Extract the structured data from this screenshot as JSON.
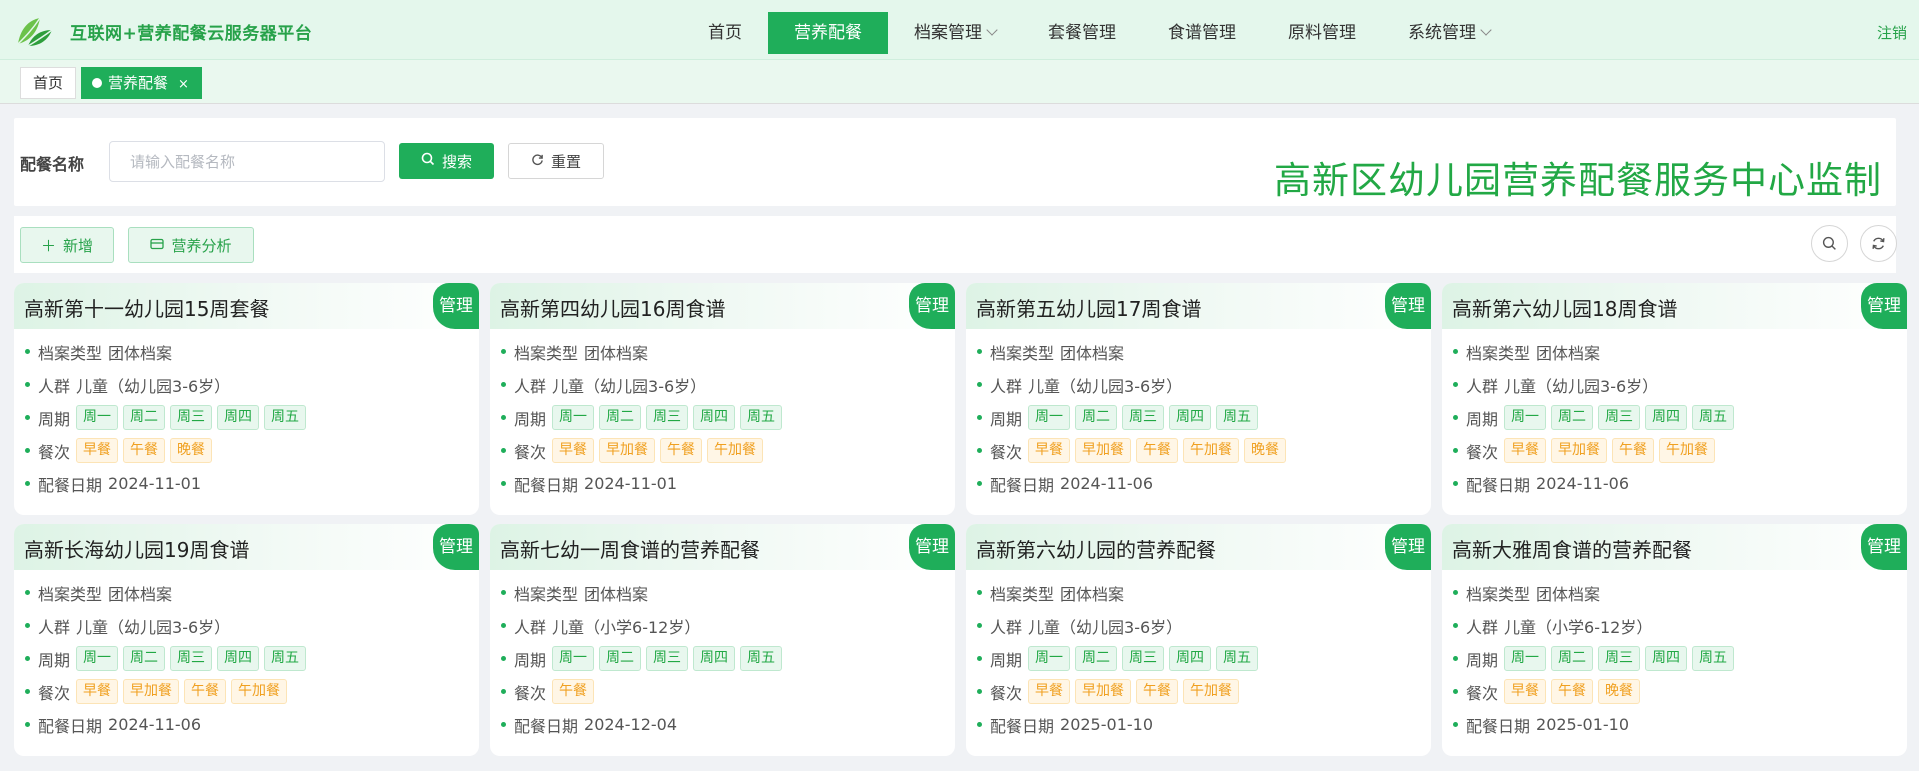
{
  "header": {
    "brand": "互联网+营养配餐云服务器平台",
    "menu": [
      {
        "label": "首页",
        "active": false,
        "dropdown": false
      },
      {
        "label": "营养配餐",
        "active": true,
        "dropdown": false
      },
      {
        "label": "档案管理",
        "active": false,
        "dropdown": true
      },
      {
        "label": "套餐管理",
        "active": false,
        "dropdown": false
      },
      {
        "label": "食谱管理",
        "active": false,
        "dropdown": false
      },
      {
        "label": "原料管理",
        "active": false,
        "dropdown": false
      },
      {
        "label": "系统管理",
        "active": false,
        "dropdown": true
      }
    ],
    "logout": "注销"
  },
  "tags": {
    "home": "首页",
    "current": "营养配餐",
    "close": "×"
  },
  "search": {
    "label": "配餐名称",
    "placeholder": "请输入配餐名称",
    "value": "",
    "search_button": "搜索",
    "reset_button": "重置",
    "monitor_title": "高新区幼儿园营养配餐服务中心监制"
  },
  "toolbar": {
    "add_label": "新增",
    "analysis_label": "营养分析"
  },
  "labels": {
    "manage": "管理",
    "archive_type": "档案类型",
    "crowd": "人群",
    "period": "周期",
    "meals": "餐次",
    "date": "配餐日期"
  },
  "colors": {
    "accent": "#1fae5a",
    "title_green": "#22a845",
    "chip_orange": "#f0a020"
  },
  "cards": [
    {
      "title": "高新第十一幼儿园15周套餐",
      "archive_type": "团体档案",
      "crowd": "儿童（幼儿园3-6岁）",
      "period": [
        "周一",
        "周二",
        "周三",
        "周四",
        "周五"
      ],
      "meals": [
        "早餐",
        "午餐",
        "晚餐"
      ],
      "date": "2024-11-01"
    },
    {
      "title": "高新第四幼儿园16周食谱",
      "archive_type": "团体档案",
      "crowd": "儿童（幼儿园3-6岁）",
      "period": [
        "周一",
        "周二",
        "周三",
        "周四",
        "周五"
      ],
      "meals": [
        "早餐",
        "早加餐",
        "午餐",
        "午加餐"
      ],
      "date": "2024-11-01"
    },
    {
      "title": "高新第五幼儿园17周食谱",
      "archive_type": "团体档案",
      "crowd": "儿童（幼儿园3-6岁）",
      "period": [
        "周一",
        "周二",
        "周三",
        "周四",
        "周五"
      ],
      "meals": [
        "早餐",
        "早加餐",
        "午餐",
        "午加餐",
        "晚餐"
      ],
      "date": "2024-11-06"
    },
    {
      "title": "高新第六幼儿园18周食谱",
      "archive_type": "团体档案",
      "crowd": "儿童（幼儿园3-6岁）",
      "period": [
        "周一",
        "周二",
        "周三",
        "周四",
        "周五"
      ],
      "meals": [
        "早餐",
        "早加餐",
        "午餐",
        "午加餐"
      ],
      "date": "2024-11-06"
    },
    {
      "title": "高新长海幼儿园19周食谱",
      "archive_type": "团体档案",
      "crowd": "儿童（幼儿园3-6岁）",
      "period": [
        "周一",
        "周二",
        "周三",
        "周四",
        "周五"
      ],
      "meals": [
        "早餐",
        "早加餐",
        "午餐",
        "午加餐"
      ],
      "date": "2024-11-06"
    },
    {
      "title": "高新七幼一周食谱的营养配餐",
      "archive_type": "团体档案",
      "crowd": "儿童（小学6-12岁）",
      "period": [
        "周一",
        "周二",
        "周三",
        "周四",
        "周五"
      ],
      "meals": [
        "午餐"
      ],
      "date": "2024-12-04"
    },
    {
      "title": "高新第六幼儿园的营养配餐",
      "archive_type": "团体档案",
      "crowd": "儿童（幼儿园3-6岁）",
      "period": [
        "周一",
        "周二",
        "周三",
        "周四",
        "周五"
      ],
      "meals": [
        "早餐",
        "早加餐",
        "午餐",
        "午加餐"
      ],
      "date": "2025-01-10"
    },
    {
      "title": "高新大雅周食谱的营养配餐",
      "archive_type": "团体档案",
      "crowd": "儿童（小学6-12岁）",
      "period": [
        "周一",
        "周二",
        "周三",
        "周四",
        "周五"
      ],
      "meals": [
        "早餐",
        "午餐",
        "晚餐"
      ],
      "date": "2025-01-10"
    }
  ]
}
